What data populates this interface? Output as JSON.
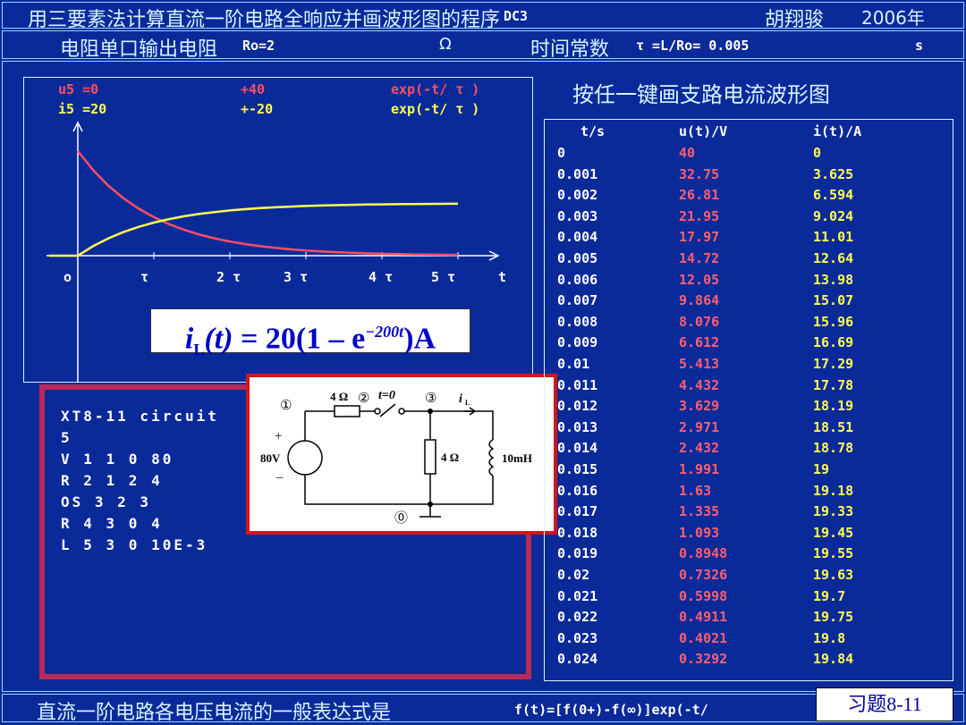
{
  "header": {
    "title": "用三要素法计算直流一阶电路全响应并画波形图的程序",
    "program": "DC3",
    "author": "胡翔骏",
    "year": "2006年"
  },
  "info": {
    "resistance_label": "电阻单口输出电阻",
    "resistance_value": "Ro=2",
    "ohm": "Ω",
    "tau_label": "时间常数",
    "tau_value": "τ =L/Ro= 0.005",
    "sec": "s"
  },
  "chart": {
    "legend1_a": "u5 =0",
    "legend1_b": "+40",
    "legend1_c": "exp(-t/ τ )",
    "legend2_a": "i5 =20",
    "legend2_b": "+-20",
    "legend2_c": "exp(-t/ τ )",
    "xticks": [
      "o",
      "τ",
      "2 τ",
      "3 τ",
      "4 τ",
      "5 τ",
      "t"
    ]
  },
  "chart_data": {
    "type": "line",
    "x": [
      0,
      0.001,
      0.002,
      0.003,
      0.004,
      0.005,
      0.006,
      0.007,
      0.008,
      0.009,
      0.01,
      0.011,
      0.012,
      0.013,
      0.014,
      0.015,
      0.016,
      0.017,
      0.018,
      0.019,
      0.02,
      0.021,
      0.022,
      0.023,
      0.024,
      0.025
    ],
    "series": [
      {
        "name": "u5",
        "color": "#ff4f5f",
        "values": [
          40,
          32.75,
          26.81,
          21.95,
          17.97,
          14.72,
          12.05,
          9.864,
          8.076,
          6.612,
          5.413,
          4.432,
          3.629,
          2.971,
          2.432,
          1.991,
          1.63,
          1.335,
          1.093,
          0.8948,
          0.7326,
          0.5998,
          0.4911,
          0.4021,
          0.3292,
          0.2695
        ]
      },
      {
        "name": "i5",
        "color": "#ffff4f",
        "values": [
          0,
          3.625,
          6.594,
          9.024,
          11.01,
          12.64,
          13.98,
          15.07,
          15.96,
          16.69,
          17.29,
          17.78,
          18.19,
          18.51,
          18.78,
          19,
          19.18,
          19.33,
          19.45,
          19.55,
          19.63,
          19.7,
          19.75,
          19.8,
          19.84,
          19.87
        ]
      }
    ]
  },
  "formula": {
    "i": "i",
    "sub": "L",
    "t": "(t)",
    "rest": " = 20(1 – e",
    "exp": "−200t",
    "end": ")A"
  },
  "netlist": {
    "lines": [
      "XT8-11 circuit",
      "5",
      "V  1 1 0 80",
      "R  2 1 2 4",
      "OS 3 2 3",
      "R  4 3 0 4",
      "L  5 3 0 10E-3"
    ]
  },
  "circuit": {
    "n1": "①",
    "n2": "②",
    "n3": "③",
    "n0": "⓪",
    "r1": "4 Ω",
    "r2": "4 Ω",
    "switch": "t=0",
    "il": "i",
    "il_sub": "L",
    "source": "80V",
    "plus": "+",
    "minus": "–",
    "inductor": "10mH"
  },
  "table": {
    "title": "按任一键画支路电流波形图",
    "headers": [
      "t/s",
      "u(t)/V",
      "i(t)/A"
    ],
    "rows": [
      [
        "0",
        "40",
        "0"
      ],
      [
        "0.001",
        "32.75",
        "3.625"
      ],
      [
        "0.002",
        "26.81",
        "6.594"
      ],
      [
        "0.003",
        "21.95",
        "9.024"
      ],
      [
        "0.004",
        "17.97",
        "11.01"
      ],
      [
        "0.005",
        "14.72",
        "12.64"
      ],
      [
        "0.006",
        "12.05",
        "13.98"
      ],
      [
        "0.007",
        "9.864",
        "15.07"
      ],
      [
        "0.008",
        "8.076",
        "15.96"
      ],
      [
        "0.009",
        "6.612",
        "16.69"
      ],
      [
        "0.01",
        "5.413",
        "17.29"
      ],
      [
        "0.011",
        "4.432",
        "17.78"
      ],
      [
        "0.012",
        "3.629",
        "18.19"
      ],
      [
        "0.013",
        "2.971",
        "18.51"
      ],
      [
        "0.014",
        "2.432",
        "18.78"
      ],
      [
        "0.015",
        "1.991",
        "19"
      ],
      [
        "0.016",
        "1.63",
        "19.18"
      ],
      [
        "0.017",
        "1.335",
        "19.33"
      ],
      [
        "0.018",
        "1.093",
        "19.45"
      ],
      [
        "0.019",
        "0.8948",
        "19.55"
      ],
      [
        "0.02",
        "0.7326",
        "19.63"
      ],
      [
        "0.021",
        "0.5998",
        "19.7"
      ],
      [
        "0.022",
        "0.4911",
        "19.75"
      ],
      [
        "0.023",
        "0.4021",
        "19.8"
      ],
      [
        "0.024",
        "0.3292",
        "19.84"
      ]
    ]
  },
  "footer": {
    "text": "直流一阶电路各电压电流的一般表达式是",
    "formula": "f(t)=[f(0+)-f(∞)]exp(-t/",
    "exercise": "习题8-11"
  }
}
